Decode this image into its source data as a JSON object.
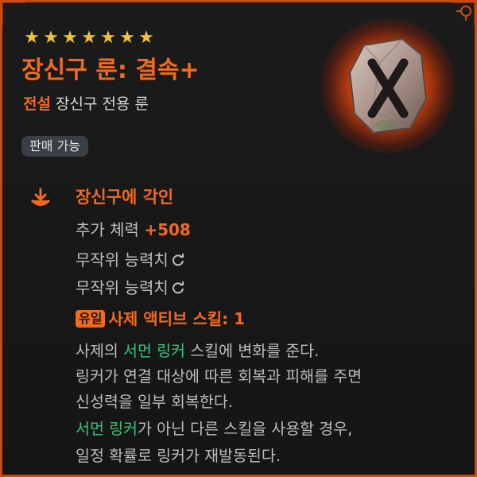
{
  "item": {
    "stars": [
      "★",
      "★",
      "★",
      "★",
      "★",
      "★",
      "★"
    ],
    "name": "장신구 룬: 결속+",
    "grade": "전설",
    "type": "장신구 전용 룬",
    "sellable_badge": "판매 가능"
  },
  "engrave": {
    "title": "장신구에 각인",
    "stat_label": "추가 체력",
    "stat_value": "+508",
    "random1": "무작위 능력치",
    "random2": "무작위 능력치",
    "unique_tag": "유일",
    "skill_text": "사제 액티브 스킬: 1"
  },
  "description": {
    "l1_a": "사제의 ",
    "l1_hl": "서먼 링커",
    "l1_b": " 스킬에 변화를 준다.",
    "l2": "링커가 연결 대상에 따른 회복과 피해를 주면",
    "l3": "신성력을 일부 회복한다.",
    "l4_hl": "서먼 링커",
    "l4_b": "가 아닌 다른 스킬을 사용할 경우,",
    "l5": "일정 확률로 링커가 재발동된다."
  },
  "colors": {
    "accent": "#f36a1c",
    "star": "#f2c230",
    "highlight": "#36c47a",
    "border": "#c94a12"
  },
  "icons": {
    "rune": "rune-stone-x-icon",
    "engrave": "engrave-download-icon",
    "reroll": "refresh-icon"
  }
}
